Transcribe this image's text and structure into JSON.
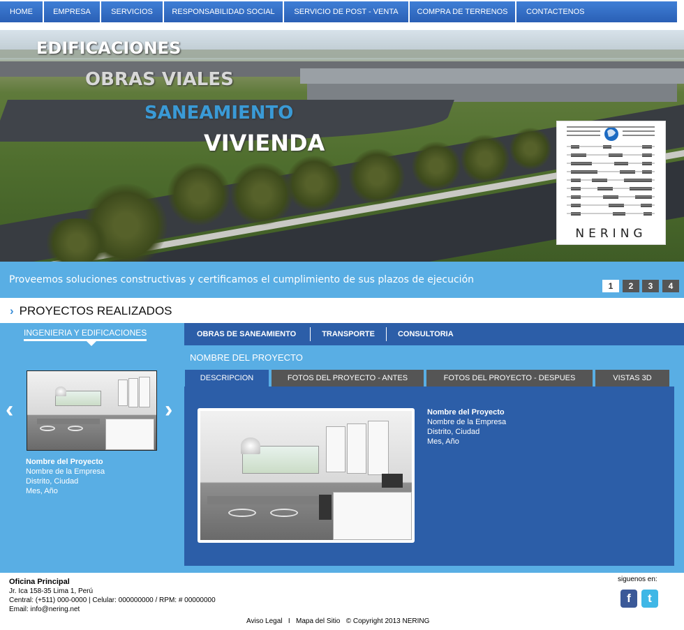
{
  "nav": {
    "items": [
      {
        "label": "HOME"
      },
      {
        "label": "EMPRESA"
      },
      {
        "label": "SERVICIOS"
      },
      {
        "label": "RESPONSABILIDAD SOCIAL"
      },
      {
        "label": "SERVICIO DE POST - VENTA"
      },
      {
        "label": "COMPRA DE TERRENOS"
      },
      {
        "label": "CONTACTENOS"
      }
    ]
  },
  "hero": {
    "words": [
      "EDIFICACIONES",
      "OBRAS VIALES",
      "SANEAMIENTO",
      "VIVIENDA"
    ],
    "logo_text": "NERING",
    "colors": {
      "white": "#ffffff",
      "light_gray": "#d8d8d8",
      "blue": "#3a9ad6"
    }
  },
  "tagline": {
    "text": "Proveemos soluciones constructivas y certificamos el cumplimiento de sus plazos de ejecución",
    "pages": [
      "1",
      "2",
      "3",
      "4"
    ],
    "active_page": "1"
  },
  "section": {
    "title": "PROYECTOS REALIZADOS"
  },
  "categories": {
    "active": "INGENIERIA Y EDIFICACIONES",
    "tabs": [
      "OBRAS DE SANEAMIENTO",
      "TRANSPORTE",
      "CONSULTORIA"
    ]
  },
  "project": {
    "title": "NOMBRE DEL PROYECTO",
    "tabs": [
      "DESCRIPCION",
      "FOTOS DEL PROYECTO - ANTES",
      "FOTOS DEL PROYECTO - DESPUES",
      "VISTAS 3D"
    ],
    "active_tab": "DESCRIPCION",
    "name": "Nombre del Proyecto",
    "company": "Nombre de la Empresa",
    "location": "Distrito, Ciudad",
    "date": "Mes, Año"
  },
  "carousel": {
    "name": "Nombre del Proyecto",
    "company": "Nombre de la Empresa",
    "location": "Distrito, Ciudad",
    "date": "Mes, Año",
    "prev_icon": "chevron-left-icon",
    "next_icon": "chevron-right-icon"
  },
  "footer": {
    "office_title": "Oficina Principal",
    "address": "Jr. Ica 158-35 Lima 1, Perú",
    "phones": "Central: (+511) 000-0000 | Celular: 000000000 / RPM: # 00000000",
    "email": "Email: info@nering.net",
    "follow": "siguenos en:",
    "legal": "Aviso Legal",
    "sep": "I",
    "sitemap": "Mapa del Sitio",
    "copyright": "© Copyright 2013 NERING",
    "social": [
      {
        "icon": "facebook-icon",
        "glyph": "f",
        "color": "#3b5998"
      },
      {
        "icon": "twitter-icon",
        "glyph": "t",
        "color": "#3fb7e6"
      }
    ]
  },
  "colors": {
    "accent": "#59aee4",
    "dark_blue": "#2c5ea8",
    "nav": "#3370c8"
  }
}
